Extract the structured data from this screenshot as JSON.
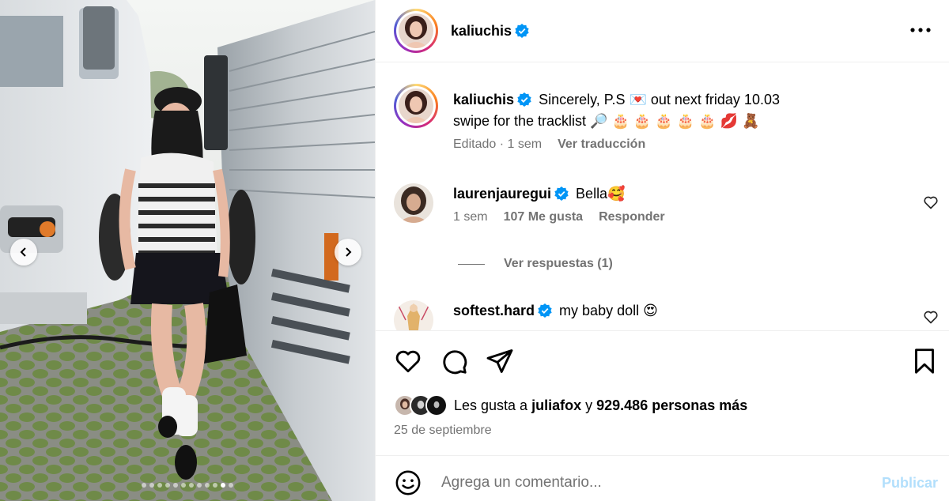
{
  "media": {
    "image_alt": "photo-woman-walking-between-tour-buses",
    "prev_icon": "chevron-left-icon",
    "next_icon": "chevron-right-icon",
    "carousel_count": 12,
    "carousel_active_index": 10
  },
  "header": {
    "username": "kaliuchis",
    "verified": true,
    "more_icon": "more-options-icon"
  },
  "caption": {
    "username": "kaliuchis",
    "line1": "Sincerely, P.S 💌 out next friday 10.03",
    "line2": "swipe for the tracklist 🔎 🎂 🎂 🎂 🎂 🎂 💋 🧸",
    "edited": "Editado",
    "sep": "·",
    "age": "1 sem",
    "translate": "Ver traducción"
  },
  "comments": [
    {
      "username": "laurenjauregui",
      "verified": true,
      "text": "Bella🥰",
      "age": "1 sem",
      "likes": "107 Me gusta",
      "reply": "Responder",
      "view_replies": "Ver respuestas (1)"
    },
    {
      "username": "softest.hard",
      "verified": true,
      "text": "my baby doll 😍"
    }
  ],
  "actions": {
    "like_icon": "heart-icon",
    "comment_icon": "comment-icon",
    "share_icon": "share-icon",
    "save_icon": "bookmark-icon"
  },
  "likes": {
    "prefix": "Les gusta a",
    "user": "juliafox",
    "middle": "y",
    "count": "929.486 personas más"
  },
  "date": "25 de septiembre",
  "composer": {
    "emoji_icon": "emoji-icon",
    "placeholder": "Agrega un comentario...",
    "publish": "Publicar"
  },
  "colors": {
    "verified": "#0095f6",
    "muted": "#737373",
    "publish_disabled": "#b2dffc"
  }
}
